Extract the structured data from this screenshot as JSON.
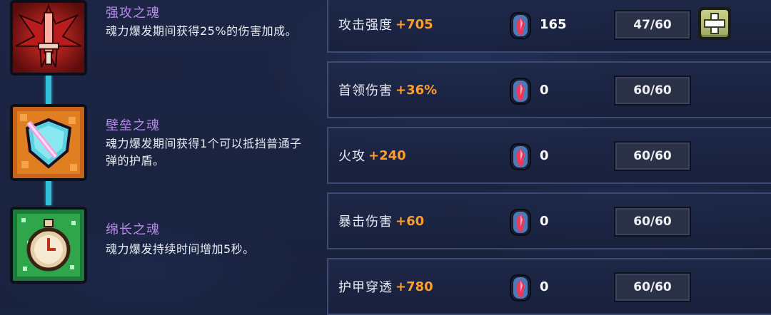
{
  "skills": [
    {
      "name": "强攻之魂",
      "desc": "魂力爆发期间获得25%的伤害加成。",
      "icon": "red-weapon-icon"
    },
    {
      "name": "壁垒之魂",
      "desc": "魂力爆发期间获得1个可以抵挡普通子弹的护盾。",
      "icon": "shield-icon"
    },
    {
      "name": "绵长之魂",
      "desc": "魂力爆发持续时间增加5秒。",
      "icon": "stopwatch-icon"
    }
  ],
  "stats": [
    {
      "label": "攻击强度",
      "bonus": "+705",
      "cost": "165",
      "level": "47/60",
      "upgradable": true
    },
    {
      "label": "首领伤害",
      "bonus": "+36%",
      "cost": "0",
      "level": "60/60",
      "upgradable": false
    },
    {
      "label": "火攻",
      "bonus": "+240",
      "cost": "0",
      "level": "60/60",
      "upgradable": false
    },
    {
      "label": "暴击伤害",
      "bonus": "+60",
      "cost": "0",
      "level": "60/60",
      "upgradable": false
    },
    {
      "label": "护甲穿透",
      "bonus": "+780",
      "cost": "0",
      "level": "60/60",
      "upgradable": false
    }
  ],
  "colors": {
    "bonus": "#ff9c2a",
    "skill_name": "#b58ae8",
    "connector": "#34c0d8"
  }
}
